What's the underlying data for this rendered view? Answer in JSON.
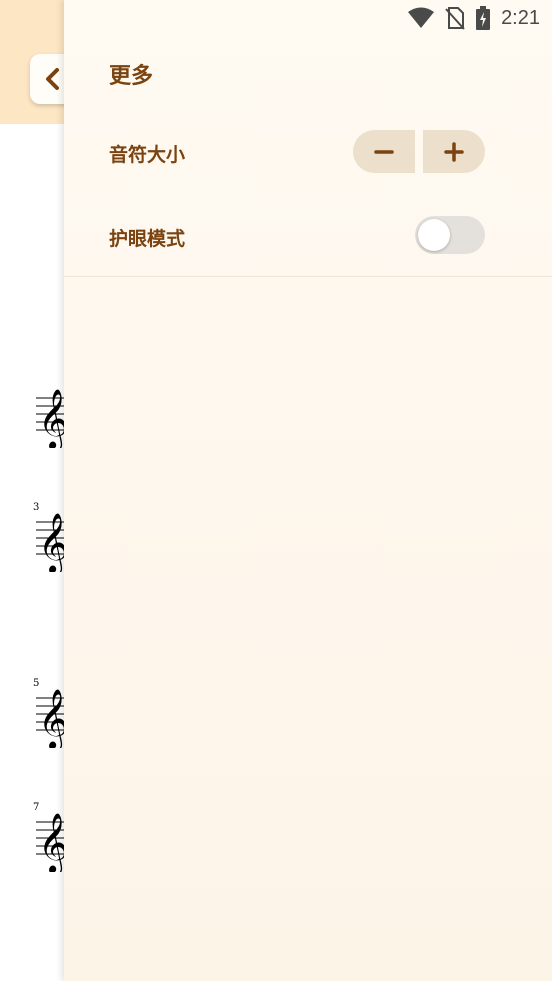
{
  "status_bar": {
    "time": "2:21",
    "icons": [
      "wifi-icon",
      "no-sim-icon",
      "battery-charging-icon"
    ]
  },
  "score": {
    "back_icon": "chevron-left-icon",
    "measure_numbers": [
      "3",
      "5",
      "7"
    ],
    "clef_icon": "treble-clef-icon"
  },
  "drawer": {
    "title": "更多",
    "note_size": {
      "label": "音符大小",
      "decrease_icon": "minus-icon",
      "increase_icon": "plus-icon"
    },
    "eye_care": {
      "label": "护眼模式",
      "enabled": false
    }
  },
  "colors": {
    "accent": "#7a4310",
    "header_bg": "#fde6c4",
    "drawer_bg": "#fffaf2",
    "stepper_bg": "#ece0cc",
    "toggle_off": "#e4e1dc"
  }
}
